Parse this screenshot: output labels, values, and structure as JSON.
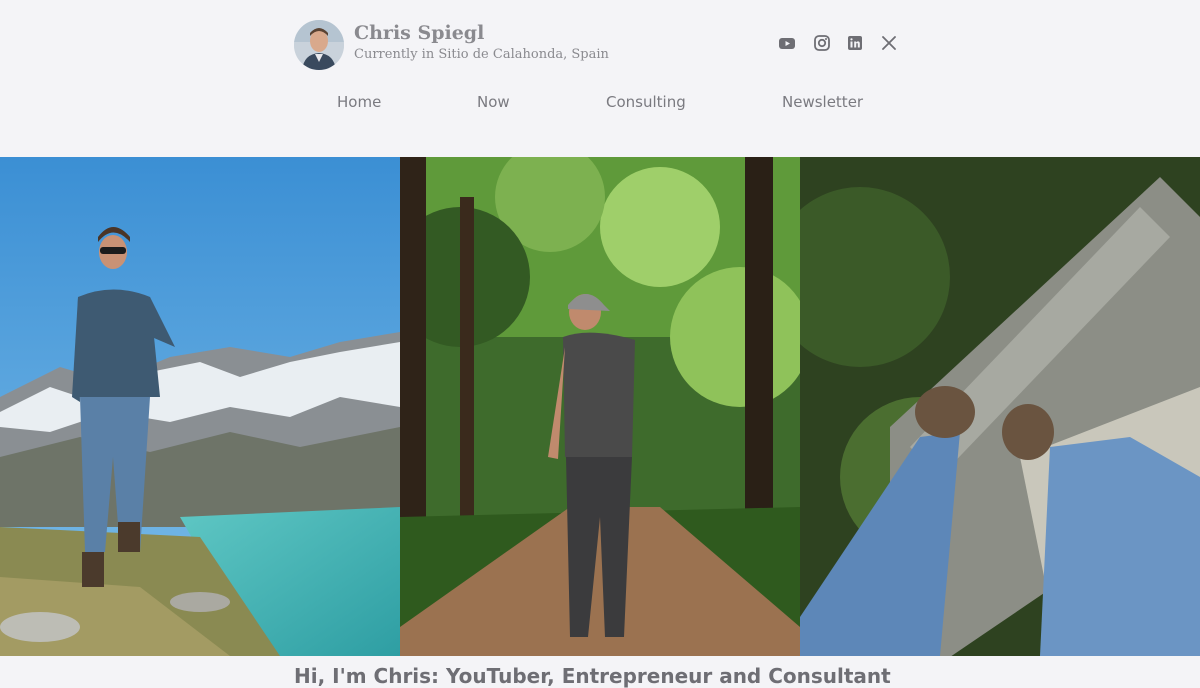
{
  "header": {
    "name": "Chris Spiegl",
    "location": "Currently in Sitio de Calahonda, Spain",
    "social": [
      "youtube-icon",
      "instagram-icon",
      "linkedin-icon",
      "x-icon"
    ]
  },
  "nav": {
    "items": [
      {
        "label": "Home"
      },
      {
        "label": "Now"
      },
      {
        "label": "Consulting"
      },
      {
        "label": "Newsletter"
      }
    ]
  },
  "colors": {
    "background": "#f4f4f7",
    "text": "#7a7a80",
    "heading": "#8a8a8f"
  },
  "intro": {
    "heading": "Hi, I'm Chris: YouTuber, Entrepreneur and Consultant"
  }
}
